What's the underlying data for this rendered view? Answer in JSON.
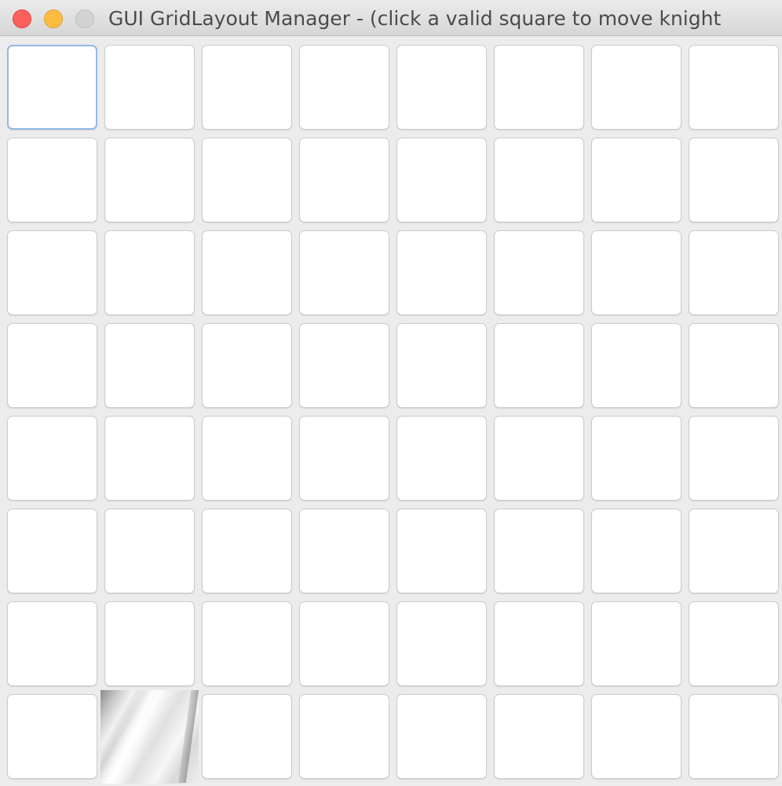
{
  "window": {
    "title": "GUI GridLayout Manager - (click a valid square to move knight",
    "controls": [
      "close",
      "minimize",
      "zoom"
    ]
  },
  "board": {
    "rows": 8,
    "cols": 8,
    "focused_square": {
      "row": 1,
      "col": 1
    },
    "knight_square": {
      "row": 8,
      "col": 2
    },
    "knight_icon": "knight-image-icon"
  }
}
